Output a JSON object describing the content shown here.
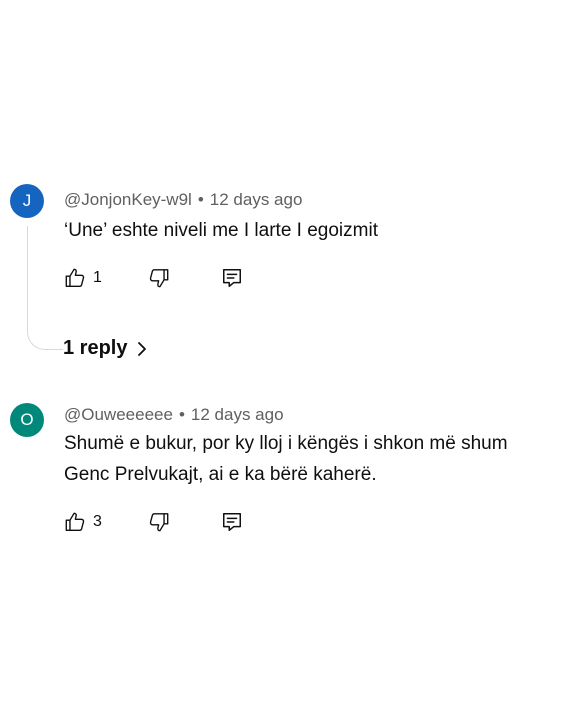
{
  "colors": {
    "avatar_j": "#1565c0",
    "avatar_o": "#00897b",
    "meta": "#606060",
    "text": "#0f0f0f"
  },
  "comments": [
    {
      "avatar_letter": "J",
      "handle": "@JonjonKey-w9l",
      "separator": "•",
      "time": "12 days ago",
      "lines": [
        "‘Une’ eshte niveli me I larte I egoizmit"
      ],
      "likes": "1",
      "icons": [
        "thumbs-up-icon",
        "thumbs-down-icon",
        "reply-icon"
      ]
    },
    {
      "avatar_letter": "O",
      "handle": "@Ouweeeeee",
      "separator": "•",
      "time": "12 days ago",
      "lines": [
        "Shumë e bukur, por ky lloj i këngës i shkon më shum",
        "Genc Prelvukajt, ai e ka bërë kaherë."
      ],
      "likes": "3",
      "icons": [
        "thumbs-up-icon",
        "thumbs-down-icon",
        "reply-icon"
      ]
    }
  ],
  "replies": {
    "label": "1 reply",
    "icon": "chevron-right-icon"
  }
}
